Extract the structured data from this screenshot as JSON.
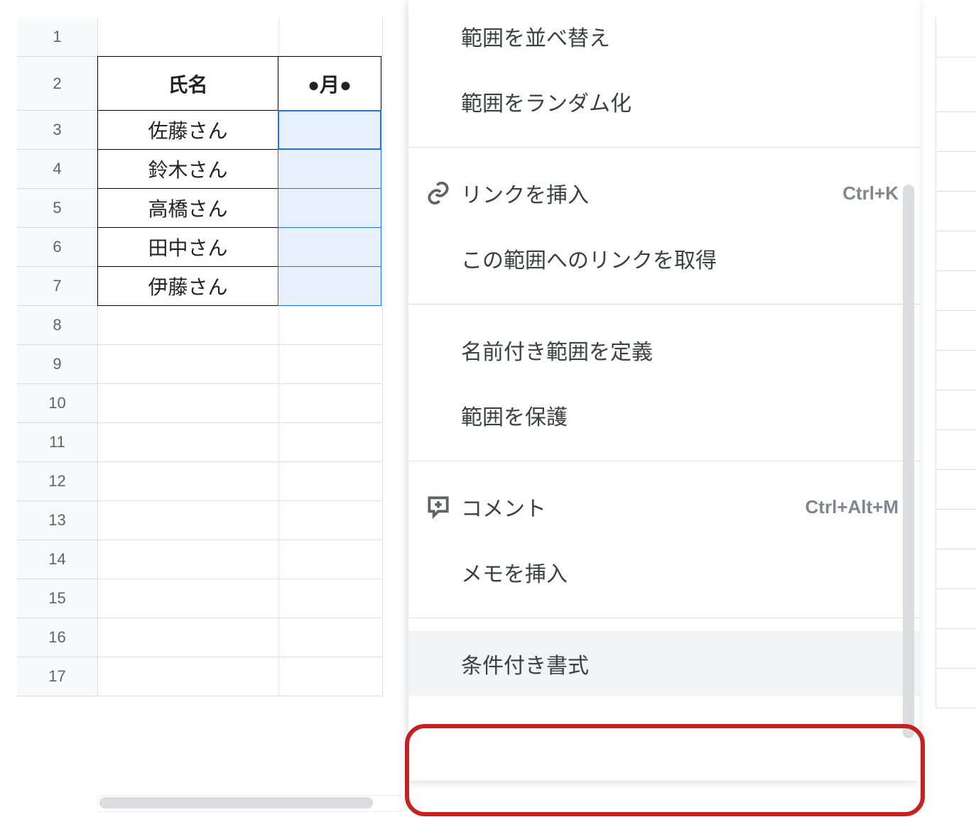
{
  "sheet": {
    "row_numbers": [
      "1",
      "2",
      "3",
      "4",
      "5",
      "6",
      "7",
      "8",
      "9",
      "10",
      "11",
      "12",
      "13",
      "14",
      "15",
      "16",
      "17"
    ],
    "header": {
      "colA": "氏名",
      "colB": "●月●"
    },
    "data_rows": [
      {
        "n": "3",
        "name": "佐藤さん"
      },
      {
        "n": "4",
        "name": "鈴木さん"
      },
      {
        "n": "5",
        "name": "高橋さん"
      },
      {
        "n": "6",
        "name": "田中さん"
      },
      {
        "n": "7",
        "name": "伊藤さん"
      }
    ]
  },
  "context_menu": {
    "items": [
      {
        "label": "範囲を並べ替え",
        "icon": null,
        "shortcut": null
      },
      {
        "label": "範囲をランダム化",
        "icon": null,
        "shortcut": null
      },
      "sep",
      {
        "label": "リンクを挿入",
        "icon": "link",
        "shortcut": "Ctrl+K"
      },
      {
        "label": "この範囲へのリンクを取得",
        "icon": null,
        "shortcut": null
      },
      "sep",
      {
        "label": "名前付き範囲を定義",
        "icon": null,
        "shortcut": null
      },
      {
        "label": "範囲を保護",
        "icon": null,
        "shortcut": null
      },
      "sep",
      {
        "label": "コメント",
        "icon": "comment",
        "shortcut": "Ctrl+Alt+M"
      },
      {
        "label": "メモを挿入",
        "icon": null,
        "shortcut": null
      },
      "sep",
      {
        "label": "条件付き書式",
        "icon": null,
        "shortcut": null,
        "hover": true,
        "highlighted": true
      }
    ]
  }
}
